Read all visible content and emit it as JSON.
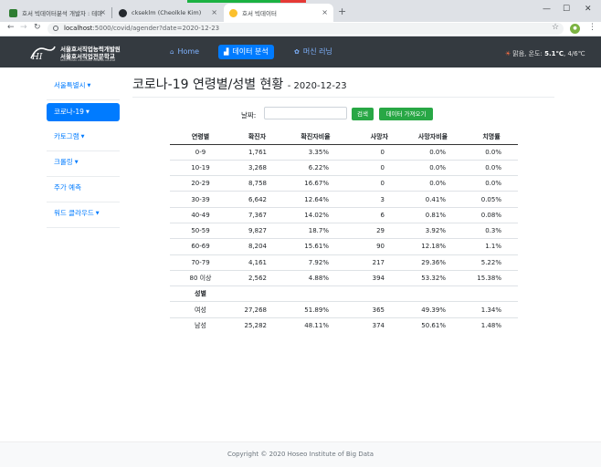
{
  "browser": {
    "tabs": [
      {
        "title": "호서 빅데이터분석 개발자 : 테마",
        "active": false
      },
      {
        "title": "ckseklm (Cheolkle Kim)",
        "active": false
      },
      {
        "title": "호서 빅데이터",
        "active": true
      }
    ],
    "url_host": "localhost",
    "url_path": ":5000/covid/agender?date=2020-12-23"
  },
  "navbar": {
    "logo_line1": "서울호서직업능력개발원",
    "logo_line2": "서울호서직업전문학교",
    "logo_line3": "SEOUL HOSEO VOCATIONAL TRAINING COLLEGE",
    "links": [
      {
        "label": "Home",
        "icon": "home-icon",
        "active": false
      },
      {
        "label": "데이터 분석",
        "icon": "chart-icon",
        "active": true
      },
      {
        "label": "머신 러닝",
        "icon": "brain-icon",
        "active": false
      }
    ],
    "weather": {
      "desc": "맑음, 온도:",
      "temp": "5.1℃",
      "range": "4/6℃"
    }
  },
  "sidebar": {
    "items": [
      {
        "label": "서울특별시",
        "dropdown": true,
        "active": false
      },
      {
        "label": "코로나-19",
        "dropdown": true,
        "active": true
      },
      {
        "label": "카토그램",
        "dropdown": true,
        "active": false
      },
      {
        "label": "크롤링",
        "dropdown": true,
        "active": false
      },
      {
        "label": "주가 예측",
        "dropdown": false,
        "active": false
      },
      {
        "label": "워드 클라우드",
        "dropdown": true,
        "active": false
      }
    ]
  },
  "main": {
    "title": "코로나-19 연령별/성별 현황",
    "date": "2020-12-23",
    "date_label": "날짜:",
    "date_value": "",
    "search_label": "검색",
    "fetch_label": "데이터 가져오기"
  },
  "table": {
    "headers": [
      "연령별",
      "확진자",
      "확진자비율",
      "사망자",
      "사망자비율",
      "치명률"
    ],
    "age_rows": [
      [
        "0-9",
        "1,761",
        "3.35%",
        "0",
        "0.0%",
        "0.0%"
      ],
      [
        "10-19",
        "3,268",
        "6.22%",
        "0",
        "0.0%",
        "0.0%"
      ],
      [
        "20-29",
        "8,758",
        "16.67%",
        "0",
        "0.0%",
        "0.0%"
      ],
      [
        "30-39",
        "6,642",
        "12.64%",
        "3",
        "0.41%",
        "0.05%"
      ],
      [
        "40-49",
        "7,367",
        "14.02%",
        "6",
        "0.81%",
        "0.08%"
      ],
      [
        "50-59",
        "9,827",
        "18.7%",
        "29",
        "3.92%",
        "0.3%"
      ],
      [
        "60-69",
        "8,204",
        "15.61%",
        "90",
        "12.18%",
        "1.1%"
      ],
      [
        "70-79",
        "4,161",
        "7.92%",
        "217",
        "29.36%",
        "5.22%"
      ],
      [
        "80 이상",
        "2,562",
        "4.88%",
        "394",
        "53.32%",
        "15.38%"
      ]
    ],
    "gender_header": "성별",
    "gender_rows": [
      [
        "여성",
        "27,268",
        "51.89%",
        "365",
        "49.39%",
        "1.34%"
      ],
      [
        "남성",
        "25,282",
        "48.11%",
        "374",
        "50.61%",
        "1.48%"
      ]
    ]
  },
  "footer": {
    "text": "Copyright © 2020 Hoseo Institute of Big Data"
  }
}
